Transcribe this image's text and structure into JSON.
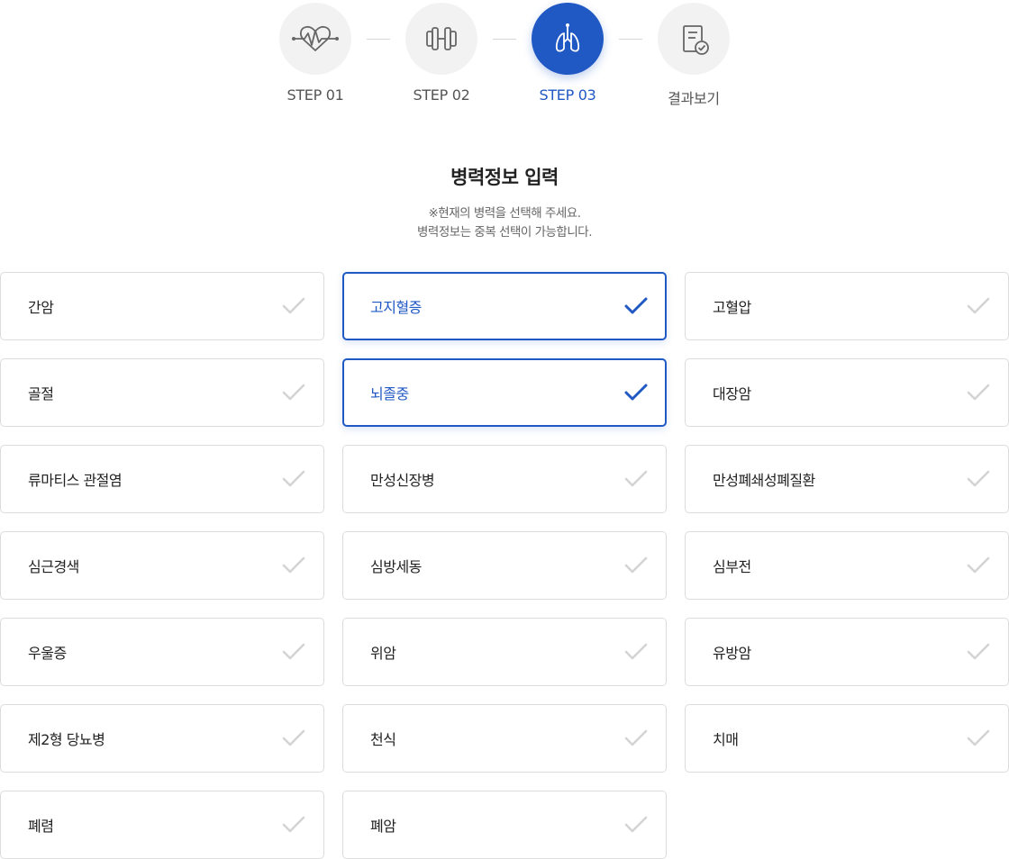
{
  "steps": [
    {
      "label": "STEP 01",
      "icon": "heartbeat-icon",
      "active": false
    },
    {
      "label": "STEP 02",
      "icon": "dumbbell-icon",
      "active": false
    },
    {
      "label": "STEP 03",
      "icon": "lungs-icon",
      "active": true
    },
    {
      "label": "결과보기",
      "icon": "document-check-icon",
      "active": false
    }
  ],
  "heading": {
    "title": "병력정보 입력",
    "desc_line1": "※현재의 병력을 선택해 주세요.",
    "desc_line2": "병력정보는 중복 선택이 가능합니다."
  },
  "colors": {
    "accent": "#2058c4",
    "check_inactive": "#d4d4d4",
    "border": "#dcdcdc"
  },
  "conditions": [
    {
      "label": "간암",
      "selected": false
    },
    {
      "label": "고지혈증",
      "selected": true
    },
    {
      "label": "고혈압",
      "selected": false
    },
    {
      "label": "골절",
      "selected": false
    },
    {
      "label": "뇌졸중",
      "selected": true
    },
    {
      "label": "대장암",
      "selected": false
    },
    {
      "label": "류마티스 관절염",
      "selected": false
    },
    {
      "label": "만성신장병",
      "selected": false
    },
    {
      "label": "만성폐쇄성폐질환",
      "selected": false
    },
    {
      "label": "심근경색",
      "selected": false
    },
    {
      "label": "심방세동",
      "selected": false
    },
    {
      "label": "심부전",
      "selected": false
    },
    {
      "label": "우울증",
      "selected": false
    },
    {
      "label": "위암",
      "selected": false
    },
    {
      "label": "유방암",
      "selected": false
    },
    {
      "label": "제2형 당뇨병",
      "selected": false
    },
    {
      "label": "천식",
      "selected": false
    },
    {
      "label": "치매",
      "selected": false
    },
    {
      "label": "폐렴",
      "selected": false
    },
    {
      "label": "폐암",
      "selected": false
    }
  ]
}
